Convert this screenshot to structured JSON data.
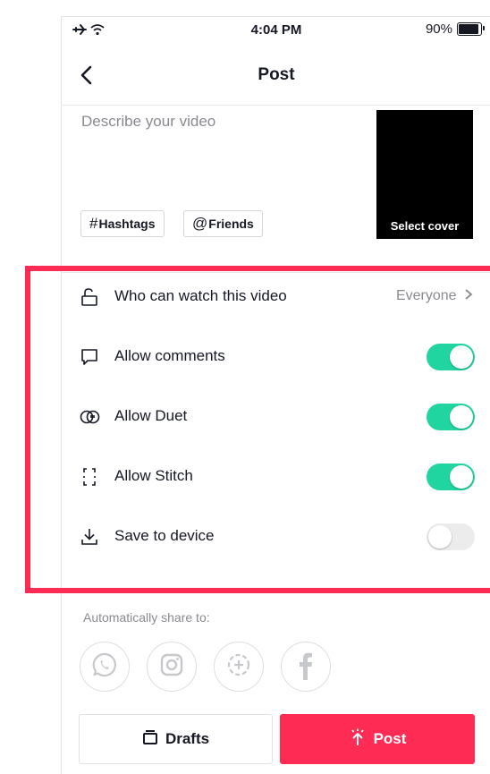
{
  "status_bar": {
    "time": "4:04 PM",
    "battery_text": "90%",
    "battery_level": 0.9,
    "icons": [
      "airplane-icon",
      "wifi-icon",
      "battery-icon"
    ]
  },
  "nav": {
    "title": "Post",
    "back_icon": "chevron-left-icon"
  },
  "caption": {
    "placeholder": "Describe your video",
    "tags": [
      {
        "symbol": "#",
        "label": "Hashtags"
      },
      {
        "symbol": "@",
        "label": "Friends"
      }
    ],
    "cover_label": "Select cover"
  },
  "settings": {
    "who_can_watch": {
      "label": "Who can watch this video",
      "value": "Everyone",
      "icon": "lock-icon"
    },
    "allow_comments": {
      "label": "Allow comments",
      "enabled": true,
      "icon": "comment-icon"
    },
    "allow_duet": {
      "label": "Allow Duet",
      "enabled": true,
      "icon": "duet-icon"
    },
    "allow_stitch": {
      "label": "Allow Stitch",
      "enabled": true,
      "icon": "stitch-icon"
    },
    "save_to_device": {
      "label": "Save to device",
      "enabled": false,
      "icon": "download-icon"
    }
  },
  "share": {
    "title": "Automatically share to:",
    "targets": [
      "whatsapp-icon",
      "instagram-icon",
      "add-share-icon",
      "facebook-icon"
    ]
  },
  "actions": {
    "drafts_label": "Drafts",
    "post_label": "Post"
  },
  "colors": {
    "accent": "#fe2c55",
    "toggle_on": "#20d5a0",
    "toggle_off": "#ececed",
    "text_primary": "#161823",
    "text_secondary": "#8a8b91"
  }
}
